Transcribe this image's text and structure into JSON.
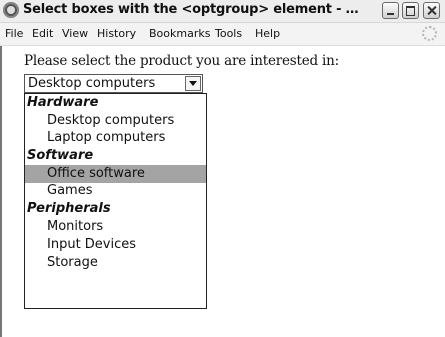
{
  "window": {
    "title": "Select boxes with the <optgroup> element - …"
  },
  "menu": {
    "items": [
      "File",
      "Edit",
      "View",
      "History",
      "Bookmarks",
      "Tools",
      "Help"
    ]
  },
  "page": {
    "prompt": "Please select the product you are interested in:",
    "select": {
      "value": "Desktop computers"
    },
    "dropdown": {
      "hardware_label": "Hardware",
      "desktop": "Desktop computers",
      "laptop": "Laptop computers",
      "software_label": "Software",
      "office": "Office software",
      "games": "Games",
      "peripherals_label": "Peripherals",
      "monitors": "Monitors",
      "input": "Input Devices",
      "storage": "Storage",
      "highlighted": "Office software"
    }
  }
}
